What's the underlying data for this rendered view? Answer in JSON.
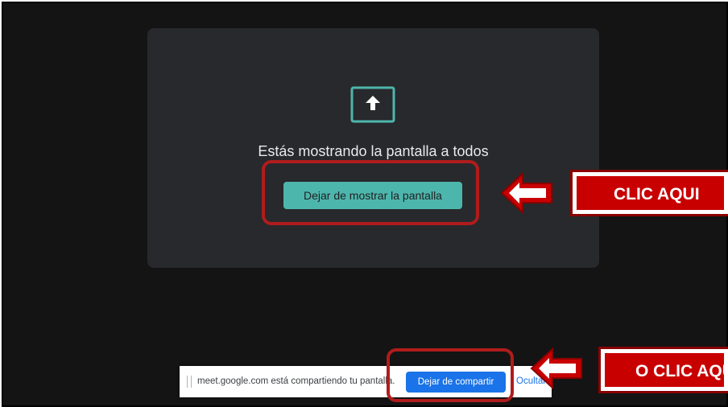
{
  "presentation": {
    "message": "Estás mostrando la pantalla a todos",
    "stop_button": "Dejar de mostrar la pantalla",
    "icon": "present-to-all-icon"
  },
  "share_bar": {
    "message": "meet.google.com está compartiendo tu pantalla.",
    "stop_button": "Dejar de compartir",
    "hide_link": "Ocultar"
  },
  "annotations": {
    "callout_top": "CLIC AQUI",
    "callout_bottom": "O CLIC AQUI"
  },
  "colors": {
    "accent_teal": "#4db6ac",
    "chrome_blue": "#1a73e8",
    "annotation_red": "#c80000"
  }
}
